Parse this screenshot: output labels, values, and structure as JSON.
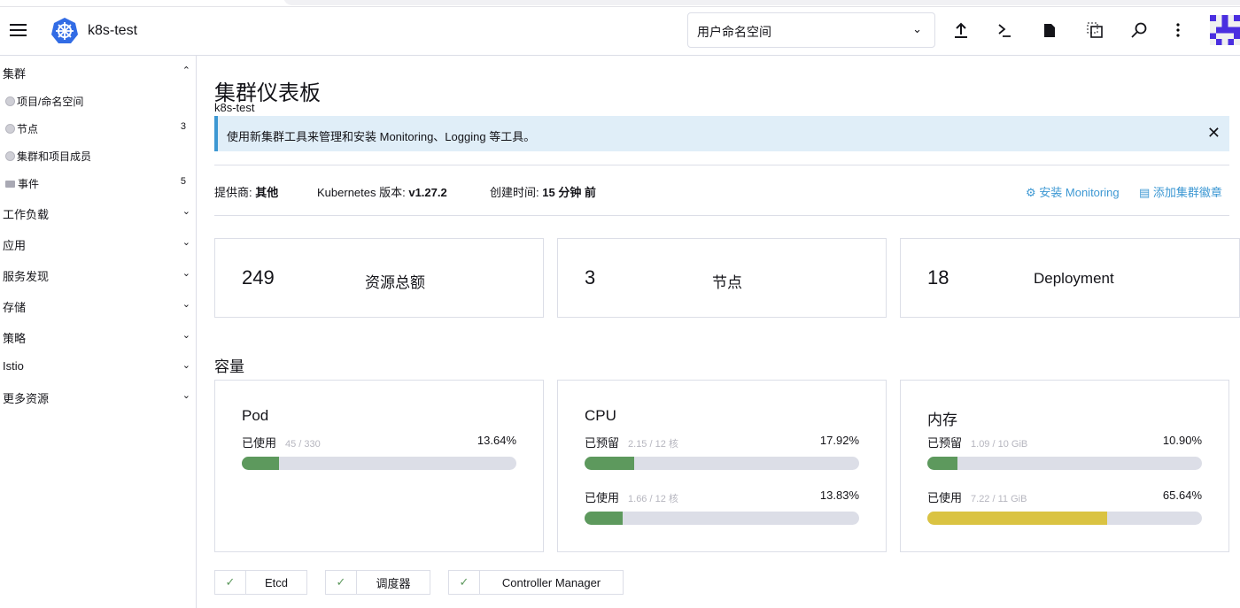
{
  "header": {
    "cluster_name": "k8s-test",
    "namespace_select": "用户命名空间",
    "icons": [
      "upload-icon",
      "terminal-icon",
      "file-icon",
      "copy-config-icon",
      "search-icon",
      "more-vertical-icon"
    ]
  },
  "sidebar": {
    "cluster_group": "集群",
    "items": [
      {
        "label": "项目/命名空间",
        "count": ""
      },
      {
        "label": "节点",
        "count": "3"
      },
      {
        "label": "集群和项目成员",
        "count": ""
      },
      {
        "label": "事件",
        "count": "5"
      }
    ],
    "groups": [
      "工作负载",
      "应用",
      "服务发现",
      "存储",
      "策略",
      "Istio",
      "更多资源"
    ]
  },
  "main": {
    "title": "集群仪表板",
    "subtitle": "k8s-test",
    "banner": "使用新集群工具来管理和安装 Monitoring、Logging 等工具。",
    "provider_label": "提供商:",
    "provider": "其他",
    "k8s_label": "Kubernetes 版本:",
    "k8s_version": "v1.27.2",
    "created_label": "创建时间:",
    "created": "15 分钟 前",
    "install_monitoring": "安装 Monitoring",
    "add_badge": "添加集群徽章",
    "counts": [
      {
        "value": "249",
        "label": "资源总额"
      },
      {
        "value": "3",
        "label": "节点"
      },
      {
        "value": "18",
        "label": "Deployment"
      }
    ],
    "capacity_title": "容量",
    "gauges": [
      {
        "title": "Pod",
        "rows": [
          {
            "label": "已使用",
            "detail": "45 / 330",
            "pct": "13.64%",
            "fill": 13.64,
            "color": "#5d995d"
          }
        ]
      },
      {
        "title": "CPU",
        "rows": [
          {
            "label": "已预留",
            "detail": "2.15 / 12 核",
            "pct": "17.92%",
            "fill": 17.92,
            "color": "#5d995d"
          },
          {
            "label": "已使用",
            "detail": "1.66 / 12 核",
            "pct": "13.83%",
            "fill": 13.83,
            "color": "#5d995d"
          }
        ]
      },
      {
        "title": "内存",
        "rows": [
          {
            "label": "已预留",
            "detail": "1.09 / 10 GiB",
            "pct": "10.90%",
            "fill": 10.9,
            "color": "#5d995d"
          },
          {
            "label": "已使用",
            "detail": "7.22 / 11 GiB",
            "pct": "65.64%",
            "fill": 65.64,
            "color": "#dac342"
          }
        ]
      }
    ],
    "components": [
      "Etcd",
      "调度器",
      "Controller Manager"
    ]
  }
}
